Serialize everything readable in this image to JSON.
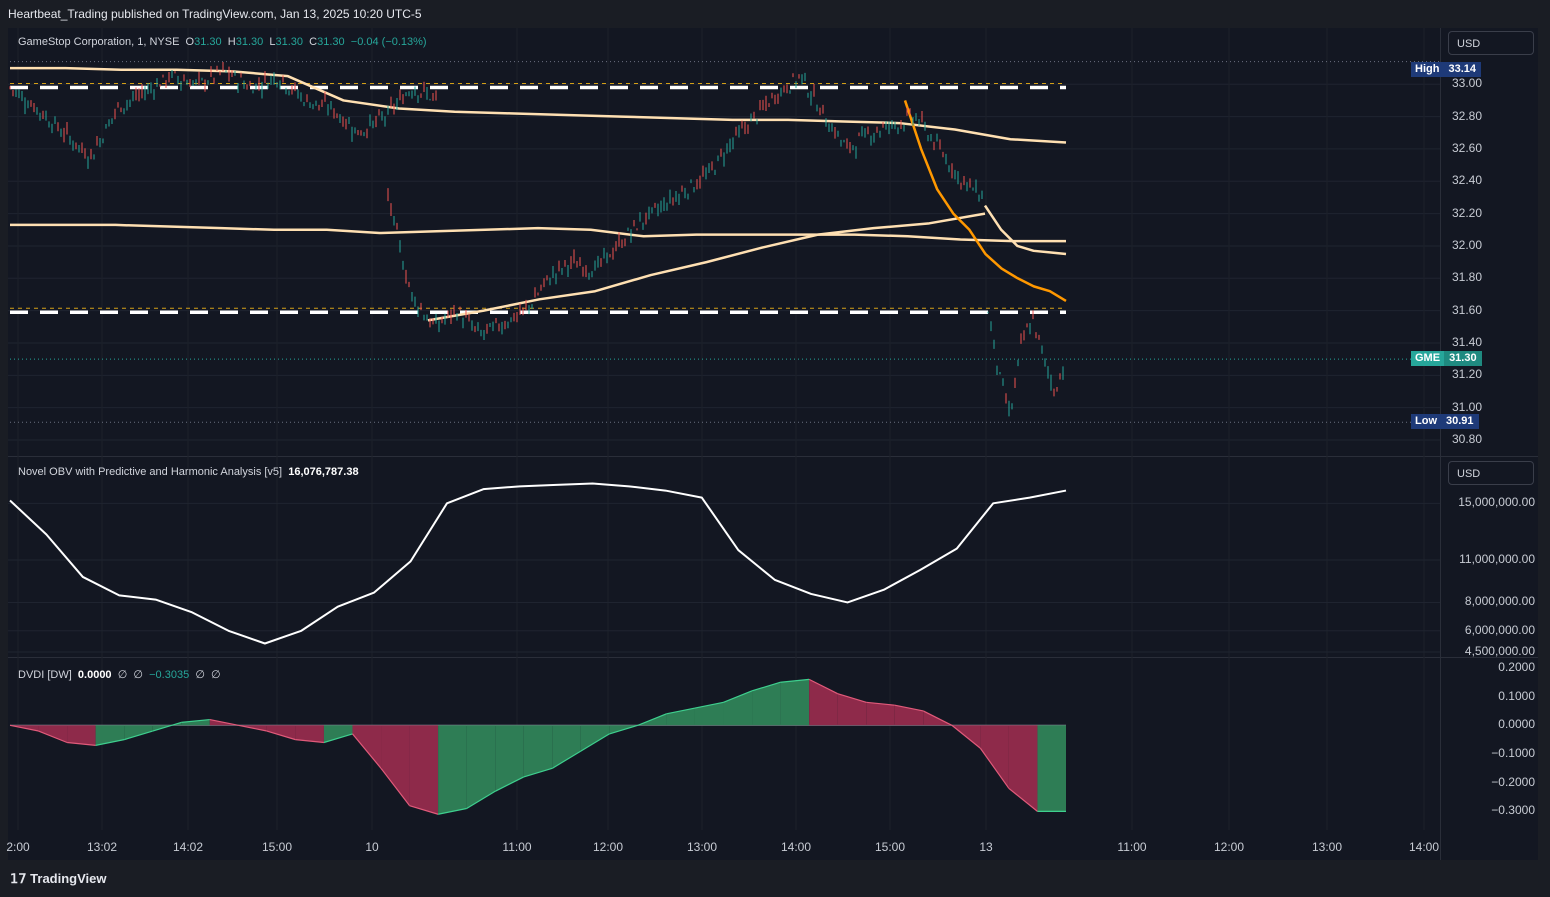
{
  "publisher_line": "Heartbeat_Trading published on TradingView.com, Jan 13, 2025 10:20 UTC-5",
  "brand": "TradingView",
  "main_legend": {
    "name": "GameStop Corporation, 1, NYSE",
    "o_label": "O",
    "o": "31.30",
    "h_label": "H",
    "h": "31.30",
    "l_label": "L",
    "l": "31.30",
    "c_label": "C",
    "c": "31.30",
    "change": "−0.04 (−0.13%)"
  },
  "obv_legend": {
    "name": "Novel OBV with Predictive and Harmonic Analysis [v5]",
    "value": "16,076,787.38"
  },
  "dvdi_legend": {
    "name": "DVDI [DW]",
    "v1": "0.0000",
    "v2": "∅",
    "v3": "∅",
    "v4": "−0.3035",
    "v5": "∅",
    "v6": "∅"
  },
  "currency": "USD",
  "tags": {
    "high_label": "High",
    "high": "33.14",
    "last_label": "GME",
    "last": "31.30",
    "low_label": "Low",
    "low": "30.91"
  },
  "colors": {
    "up": "#26a69a",
    "down": "#ef5350",
    "band": "#ffe0b2",
    "band_accent": "#ff9800",
    "obv": "#ffffff",
    "dvdi_green": "#2e7d55",
    "dvdi_red": "#8e2a4a",
    "level": "#ffffff"
  },
  "chart_data": [
    {
      "type": "line",
      "panel": "price",
      "price_ticks": [
        "33.00",
        "32.80",
        "32.60",
        "32.40",
        "32.20",
        "32.00",
        "31.80",
        "31.60",
        "31.40",
        "31.20",
        "31.00",
        "30.80"
      ],
      "ylim": [
        30.8,
        33.15
      ],
      "x_ticks": [
        "2:00",
        "13:02",
        "14:02",
        "15:00",
        "10",
        "11:00",
        "12:00",
        "13:00",
        "14:00",
        "15:00",
        "13",
        "11:00",
        "12:00",
        "13:00",
        "14:00"
      ],
      "key_levels": [
        32.98,
        31.59
      ],
      "series": [
        {
          "name": "GME",
          "values": [
            32.98,
            32.85,
            32.7,
            32.55,
            32.85,
            32.95,
            33.05,
            33.0,
            33.08,
            32.98,
            33.05,
            32.9,
            32.85,
            32.7,
            32.8,
            32.98,
            32.9,
            32.3,
            31.7,
            31.5,
            31.6,
            31.45,
            31.52,
            31.6,
            31.8,
            31.9,
            31.85,
            32.0,
            32.15,
            32.25,
            32.35,
            32.45,
            32.65,
            32.8,
            32.95,
            33.05,
            32.8,
            32.6,
            32.7,
            32.75,
            32.8,
            32.6,
            32.4,
            32.3,
            31.6,
            31.2,
            30.95,
            31.4,
            31.55,
            31.3,
            31.1,
            31.3
          ]
        },
        {
          "values": [
            32.13,
            32.13,
            32.13,
            32.12,
            32.11,
            32.1,
            32.1,
            32.08,
            32.09,
            32.1,
            32.11,
            32.1,
            32.06,
            32.07,
            32.07,
            32.07,
            32.07,
            32.06,
            32.04,
            32.03,
            32.03
          ]
        },
        {
          "values": [
            31.54,
            31.6,
            31.67,
            31.72,
            31.82,
            31.9,
            31.99,
            32.07,
            32.11,
            32.14,
            32.2
          ]
        },
        {
          "values": [
            32.9,
            32.6,
            32.35,
            32.2,
            32.1,
            31.95,
            31.86,
            31.8,
            31.75,
            31.72,
            31.66
          ]
        }
      ]
    },
    {
      "type": "line",
      "panel": "obv",
      "ticks": [
        "15,000,000.00",
        "11,000,000.00",
        "8,000,000.00",
        "6,000,000.00",
        "4,500,000.00"
      ],
      "ylim": [
        4500000,
        17000000
      ],
      "series": [
        {
          "name": "Novel OBV with Predictive and Harmonic Analysis [v5]",
          "values": [
            15200000,
            12800000,
            9800000,
            8500000,
            8200000,
            7300000,
            6000000,
            5100000,
            6000000,
            7700000,
            8700000,
            10900000,
            15000000,
            16000000,
            16200000,
            16300000,
            16400000,
            16200000,
            15900000,
            15400000,
            11700000,
            9600000,
            8600000,
            8000000,
            8900000,
            10300000,
            11800000,
            15000000,
            15400000,
            15900000
          ]
        }
      ]
    },
    {
      "type": "area",
      "panel": "dvdi",
      "ticks": [
        "0.2000",
        "0.1000",
        "0.0000",
        "−0.1000",
        "−0.2000",
        "−0.3000"
      ],
      "ylim": [
        -0.33,
        0.21
      ],
      "series": [
        {
          "name": "DVDI [DW]",
          "values": [
            0.0,
            -0.02,
            -0.06,
            -0.07,
            -0.05,
            -0.02,
            0.01,
            0.02,
            0.0,
            -0.02,
            -0.05,
            -0.06,
            -0.03,
            -0.15,
            -0.28,
            -0.31,
            -0.29,
            -0.23,
            -0.18,
            -0.15,
            -0.09,
            -0.03,
            0.0,
            0.04,
            0.06,
            0.08,
            0.12,
            0.15,
            0.16,
            0.11,
            0.08,
            0.07,
            0.05,
            0.0,
            -0.08,
            -0.22,
            -0.3,
            -0.3
          ]
        }
      ]
    }
  ]
}
